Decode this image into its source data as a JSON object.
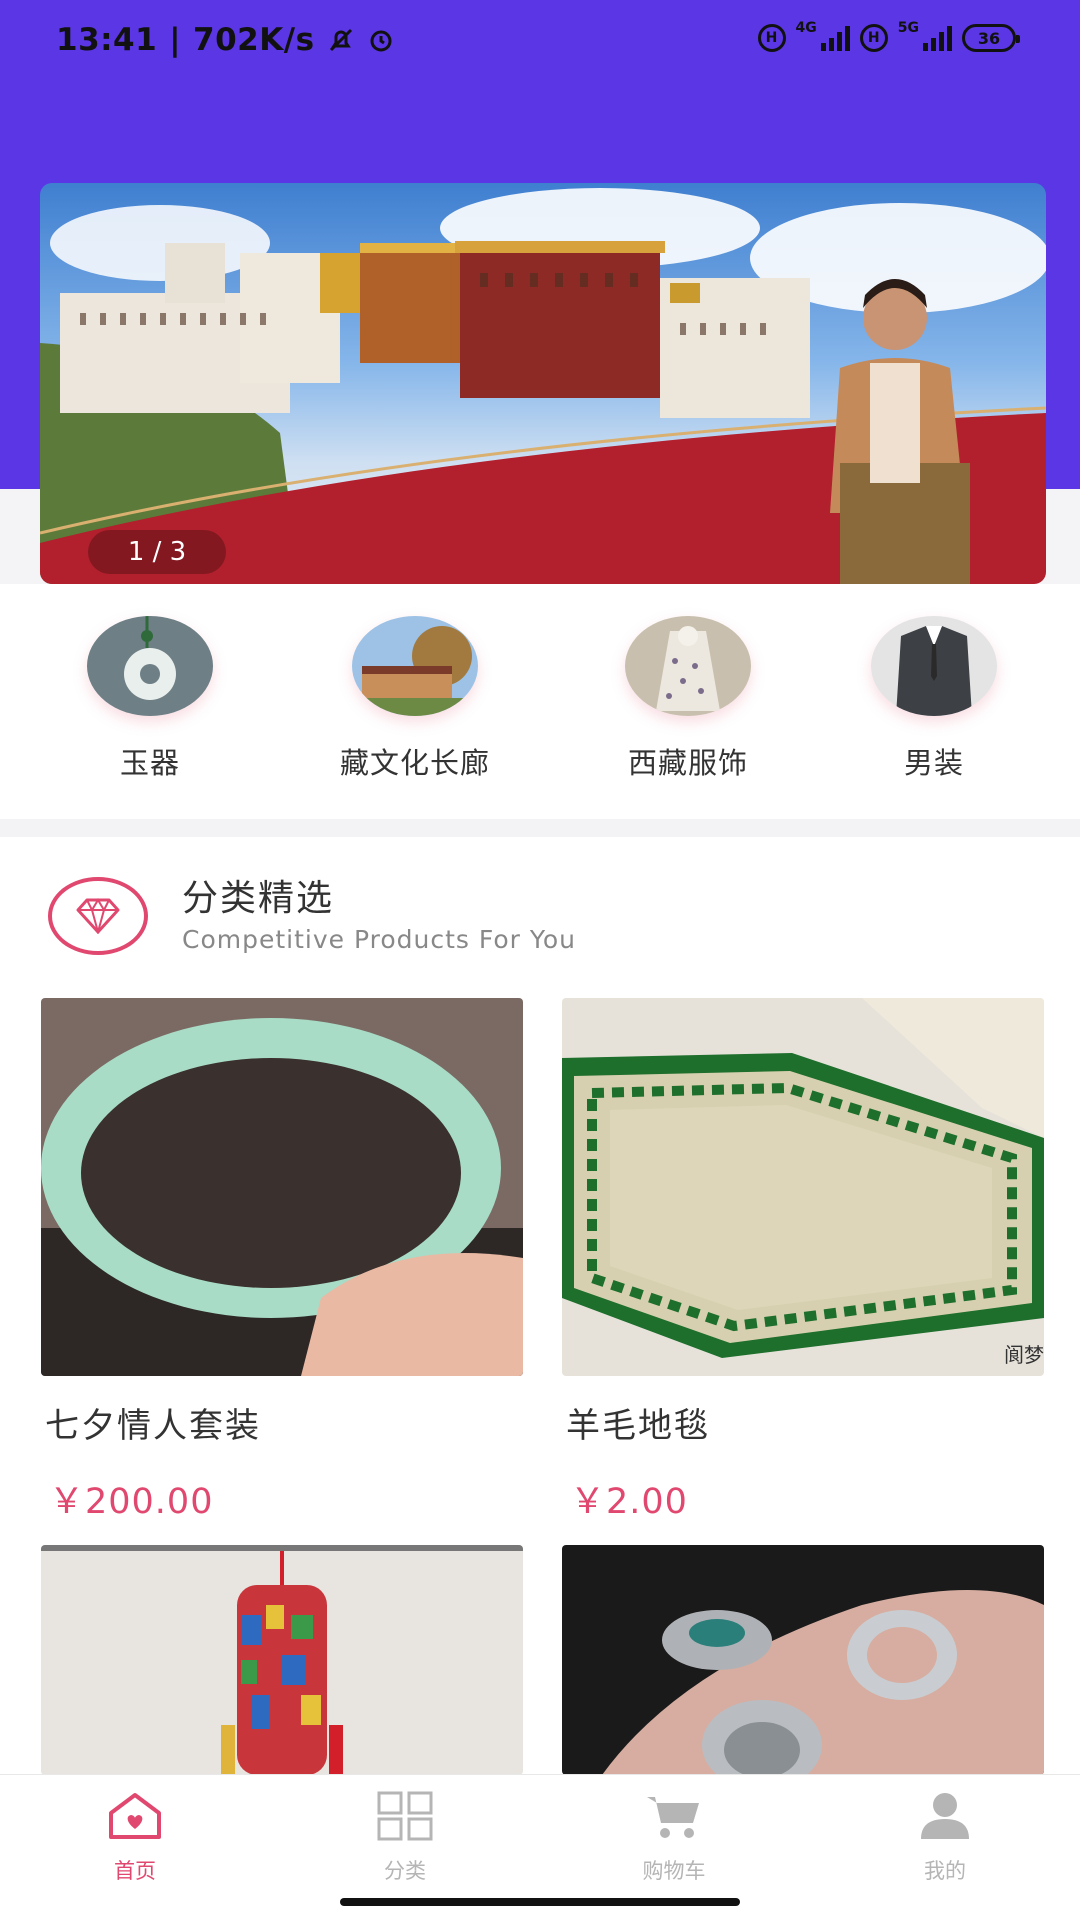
{
  "status_bar": {
    "time": "13:41",
    "speed": "702K/s",
    "net1": "4G",
    "net2": "5G",
    "battery": "36"
  },
  "banner": {
    "counter": "1 / 3",
    "slide_index": 1,
    "slide_total": 3
  },
  "categories": [
    {
      "label": "玉器"
    },
    {
      "label": "藏文化长廊"
    },
    {
      "label": "西藏服饰"
    },
    {
      "label": "男装"
    }
  ],
  "section": {
    "title": "分类精选",
    "subtitle": "Competitive Products For You"
  },
  "products": [
    {
      "name": "七夕情人套装",
      "price": "￥200.00"
    },
    {
      "name": "羊毛地毯",
      "price": "￥2.00",
      "watermark": "阆梦"
    },
    {
      "name": "",
      "price": ""
    },
    {
      "name": "",
      "price": ""
    }
  ],
  "tabbar": {
    "items": [
      {
        "label": "首页",
        "icon": "home-icon"
      },
      {
        "label": "分类",
        "icon": "grid-icon"
      },
      {
        "label": "购物车",
        "icon": "cart-icon"
      },
      {
        "label": "我的",
        "icon": "user-icon"
      }
    ],
    "active_color": "#e0486f",
    "inactive_color": "#b5b5b5"
  },
  "colors": {
    "header_purple": "#5b36e4",
    "accent_pink": "#e0486f"
  }
}
